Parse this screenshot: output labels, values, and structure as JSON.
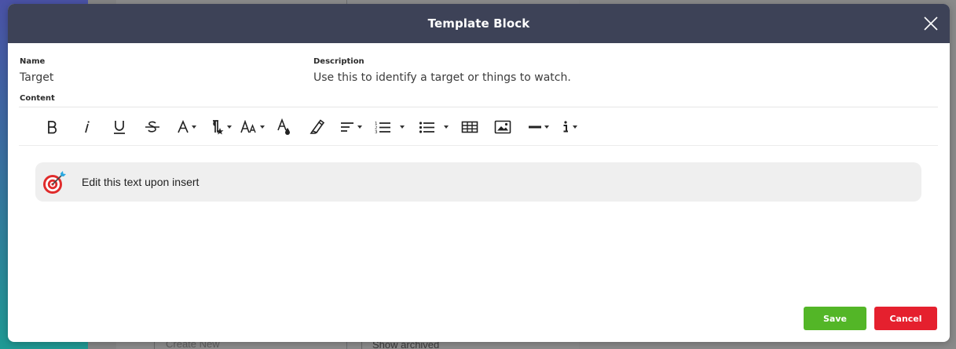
{
  "background": {
    "create_new": "Create New",
    "show_archived": "Show archived"
  },
  "modal": {
    "title": "Template Block",
    "fields": {
      "name_label": "Name",
      "name_value": "Target",
      "description_label": "Description",
      "description_value": "Use this to identify a target or things to watch.",
      "content_label": "Content"
    },
    "toolbar": [
      {
        "icon": "bold-icon"
      },
      {
        "icon": "italic-icon"
      },
      {
        "icon": "underline-icon"
      },
      {
        "icon": "strikethrough-icon"
      },
      {
        "icon": "font-color-icon"
      },
      {
        "icon": "paragraph-style-icon"
      },
      {
        "icon": "font-size-icon"
      },
      {
        "icon": "text-color-drop-icon"
      },
      {
        "icon": "highlighter-icon"
      },
      {
        "icon": "align-icon"
      },
      {
        "icon": "ordered-list-icon"
      },
      {
        "icon": "unordered-list-icon"
      },
      {
        "icon": "table-icon"
      },
      {
        "icon": "image-icon"
      },
      {
        "icon": "horizontal-line-icon"
      },
      {
        "icon": "info-icon"
      }
    ],
    "block": {
      "icon": "target-dart-icon",
      "text": "Edit this text upon insert"
    },
    "buttons": {
      "save": "Save",
      "cancel": "Cancel"
    },
    "colors": {
      "header": "#3d4257",
      "save": "#53b627",
      "cancel": "#e5202e",
      "block_bg": "#efefef"
    }
  }
}
